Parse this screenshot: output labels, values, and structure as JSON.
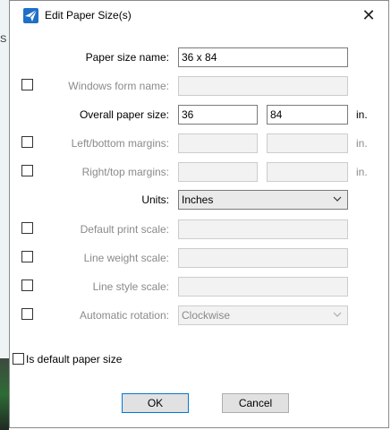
{
  "window": {
    "title": "Edit Paper Size(s)",
    "close_glyph": "✕"
  },
  "background": {
    "edge_letter": "S"
  },
  "fields": {
    "paper_size_name": {
      "label": "Paper size name:",
      "value": "36 x 84"
    },
    "windows_form_name": {
      "label": "Windows form name:",
      "value": ""
    },
    "overall_paper_size": {
      "label": "Overall paper size:",
      "width": "36",
      "height": "84",
      "unit": "in."
    },
    "left_bottom_margins": {
      "label": "Left/bottom margins:",
      "left": "",
      "bottom": "",
      "unit": "in."
    },
    "right_top_margins": {
      "label": "Right/top margins:",
      "right": "",
      "top": "",
      "unit": "in."
    },
    "units": {
      "label": "Units:",
      "selected": "Inches"
    },
    "default_print_scale": {
      "label": "Default print scale:",
      "value": ""
    },
    "line_weight_scale": {
      "label": "Line weight scale:",
      "value": ""
    },
    "line_style_scale": {
      "label": "Line style scale:",
      "value": ""
    },
    "automatic_rotation": {
      "label": "Automatic rotation:",
      "selected": "Clockwise"
    }
  },
  "is_default": {
    "label": "Is default paper size",
    "checked": false
  },
  "buttons": {
    "ok": "OK",
    "cancel": "Cancel"
  },
  "colors": {
    "accent": "#0078d7",
    "disabled_text": "#8a8a8a"
  },
  "icons": {
    "app": "paper-plane-icon",
    "close": "close-icon",
    "dropdown": "chevron-down-icon"
  }
}
